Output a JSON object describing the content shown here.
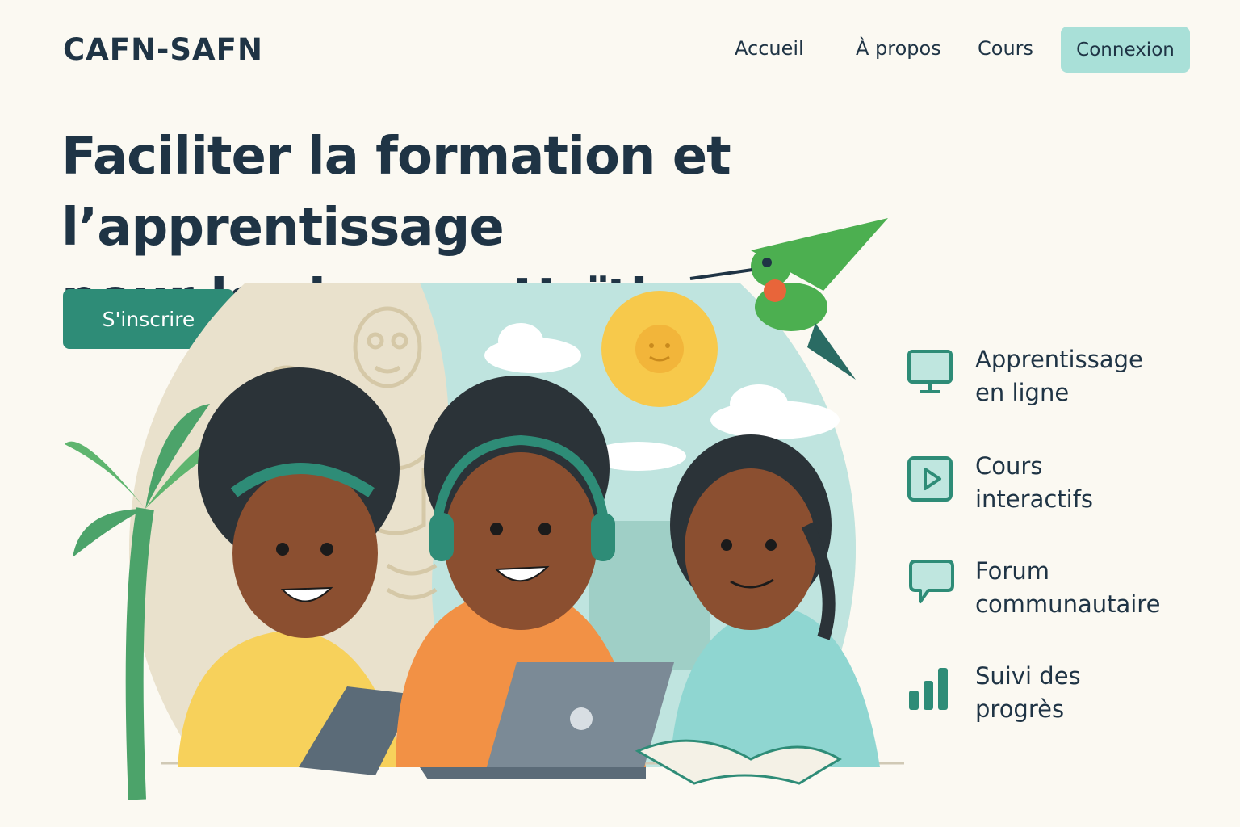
{
  "header": {
    "logo": "CAFN-SAFN",
    "nav": {
      "home": "Accueil",
      "about": "À propos",
      "courses": "Cours",
      "login": "Connexion"
    }
  },
  "hero": {
    "title_line1": "Faciliter la formation et l’apprentissage",
    "title_line2": "pour les jeunes Haïtiens",
    "cta": "S'inscrire"
  },
  "features": [
    {
      "icon": "monitor-icon",
      "line1": "Apprentissage",
      "line2": "en ligne"
    },
    {
      "icon": "play-icon",
      "line1": "Cours",
      "line2": "interactifs"
    },
    {
      "icon": "chat-icon",
      "line1": "Forum",
      "line2": "communautaire"
    },
    {
      "icon": "bar-chart-icon",
      "line1": "Suivi des",
      "line2": "progrès"
    }
  ],
  "colors": {
    "background": "#fbf9f2",
    "primary": "#2e8c77",
    "accent_light": "#a9e0d8",
    "text": "#1f3445"
  }
}
